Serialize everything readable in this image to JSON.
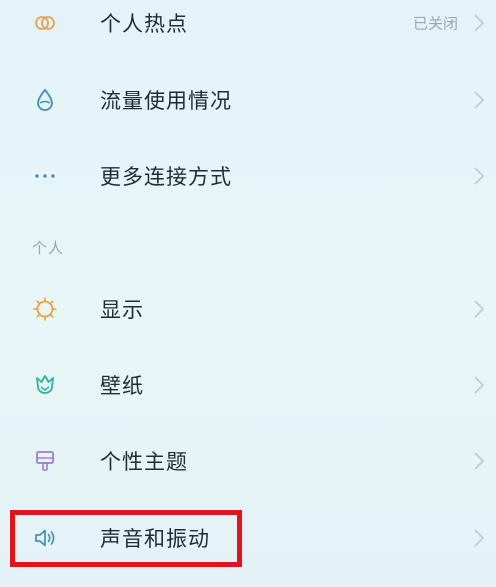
{
  "settings": {
    "items": [
      {
        "label": "个人热点",
        "value": "已关闭",
        "icon": "hotspot-icon"
      },
      {
        "label": "流量使用情况",
        "value": "",
        "icon": "data-drop-icon"
      },
      {
        "label": "更多连接方式",
        "value": "",
        "icon": "more-dots-icon"
      }
    ],
    "section_personal": "个人",
    "personal_items": [
      {
        "label": "显示",
        "icon": "sun-icon"
      },
      {
        "label": "壁纸",
        "icon": "wallpaper-tulip-icon"
      },
      {
        "label": "个性主题",
        "icon": "theme-brush-icon"
      },
      {
        "label": "声音和振动",
        "icon": "speaker-icon"
      }
    ]
  },
  "colors": {
    "highlight": "#e0141c",
    "hotspot": "#e3a35a",
    "data": "#3f8fb8",
    "more": "#3f8fb8",
    "display": "#e8a23c",
    "wallpaper": "#2fb39a",
    "theme": "#a27ad4",
    "sound": "#3f8fb8"
  }
}
